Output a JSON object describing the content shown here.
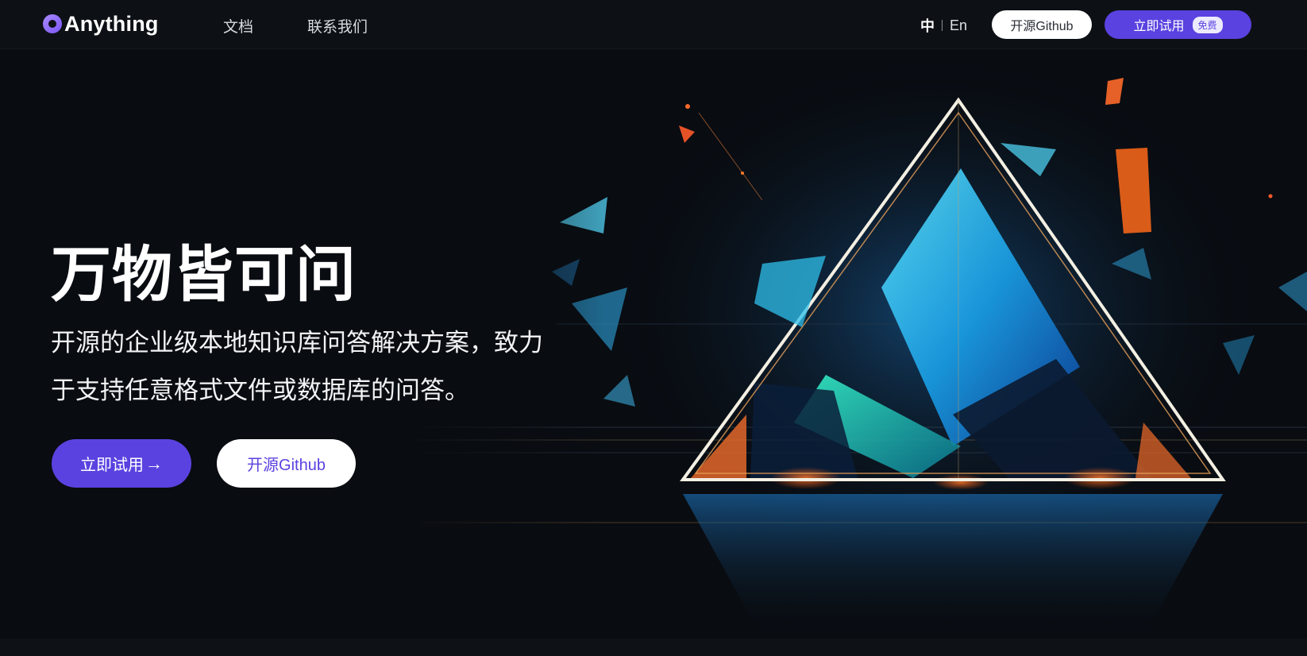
{
  "header": {
    "logo_text": "Anything",
    "nav": [
      {
        "label": "文档"
      },
      {
        "label": "联系我们"
      }
    ],
    "lang": {
      "zh": "中",
      "en": "En"
    },
    "github_button": "开源Github",
    "try_button": "立即试用",
    "free_badge": "免费"
  },
  "hero": {
    "title": "万物皆可问",
    "subtitle_lines": [
      "开源的企业级本地知识库问答解决方案，致力",
      "于支持任意格式文件或数据库的问答。"
    ],
    "try_button": "立即试用",
    "arrow": "→",
    "github_button": "开源Github"
  },
  "colors": {
    "accent": "#5a42e0",
    "background": "#0c0f13"
  }
}
